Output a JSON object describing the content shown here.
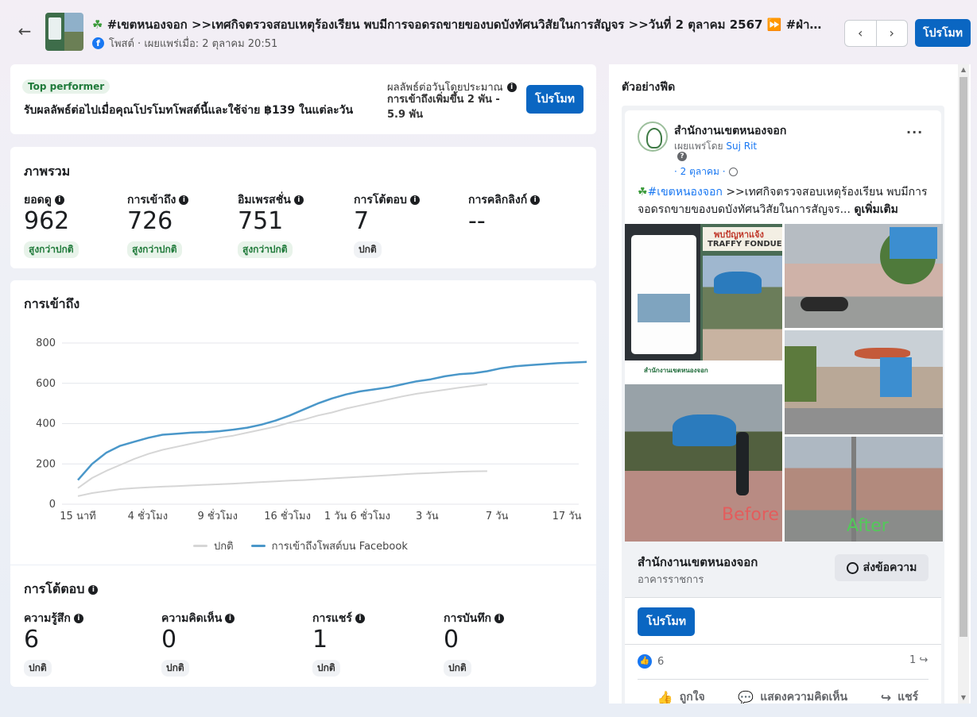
{
  "header": {
    "post_title": "#เขตหนองจอก >>เทศกิจตรวจสอบเหตุร้องเรียน พบมีการจอดรถขายของบดบังทัศนวิสัยในการสัญจร >>วันที่ 2 ตุลาคม 2567 ⏩ #ฝ่า…",
    "post_meta": "โพสต์ · เผยแพร่เมื่อ: 2 ตุลาคม 20:51",
    "prev_label": "‹",
    "next_label": "›",
    "promote_label": "โปรโมท"
  },
  "top_performer": {
    "badge": "Top performer",
    "message": "รับผลลัพธ์ต่อไปเมื่อคุณโปรโมทโพสต์นี้และใช้จ่าย ฿139 ในแต่ละวัน",
    "estimate_label": "ผลลัพธ์ต่อวันโดยประมาณ",
    "estimate_value": "การเข้าถึงเพิ่มขึ้น 2 พัน - 5.9 พัน",
    "promote_label": "โปรโมท"
  },
  "overview": {
    "title": "ภาพรวม",
    "metrics": [
      {
        "label": "ยอดดู",
        "value": "962",
        "badge": "สูงกว่าปกติ"
      },
      {
        "label": "การเข้าถึง",
        "value": "726",
        "badge": "สูงกว่าปกติ"
      },
      {
        "label": "อิมเพรสชั่น",
        "value": "751",
        "badge": "สูงกว่าปกติ"
      },
      {
        "label": "การโต้ตอบ",
        "value": "7",
        "badge": "ปกติ"
      },
      {
        "label": "การคลิกลิงก์",
        "value": "--",
        "badge": ""
      }
    ]
  },
  "reach": {
    "title": "การเข้าถึง",
    "legend_normal": "ปกติ",
    "legend_fb": "การเข้าถึงโพสต์บน Facebook"
  },
  "chart_data": {
    "type": "line",
    "title": "การเข้าถึง",
    "xlabel": "",
    "ylabel": "",
    "ylim": [
      0,
      800
    ],
    "yticks": [
      0,
      200,
      400,
      600,
      800
    ],
    "x_tick_labels": [
      "15 นาที",
      "4 ชั่วโมง",
      "9 ชั่วโมง",
      "16 ชั่วโมง",
      "1 วัน 6 ชั่วโมง",
      "3 วัน",
      "7 วัน",
      "17 วัน"
    ],
    "grid": true,
    "legend_position": "bottom",
    "series": [
      {
        "name": "การเข้าถึงโพสต์บน Facebook",
        "color": "#4a97c9",
        "values": [
          120,
          200,
          255,
          290,
          310,
          330,
          345,
          350,
          355,
          358,
          362,
          370,
          380,
          395,
          415,
          440,
          470,
          500,
          525,
          545,
          560,
          570,
          580,
          595,
          610,
          620,
          635,
          645,
          650,
          660,
          675,
          685,
          690,
          695,
          700,
          703,
          706,
          725
        ]
      },
      {
        "name": "ปกติ",
        "color": "#d6d6d6",
        "values": [
          80,
          130,
          165,
          195,
          225,
          250,
          270,
          285,
          300,
          315,
          330,
          340,
          355,
          370,
          385,
          405,
          420,
          440,
          455,
          475,
          490,
          505,
          520,
          535,
          548,
          558,
          568,
          578,
          587,
          595
        ]
      },
      {
        "name": "ปกติ",
        "color": "#d6d6d6",
        "values": [
          40,
          55,
          65,
          75,
          80,
          84,
          87,
          90,
          93,
          96,
          99,
          102,
          106,
          110,
          113,
          117,
          120,
          124,
          128,
          132,
          136,
          140,
          144,
          148,
          152,
          155,
          158,
          161,
          163,
          164
        ]
      }
    ]
  },
  "engagement": {
    "title": "การโต้ตอบ",
    "metrics": [
      {
        "label": "ความรู้สึก",
        "value": "6",
        "badge": "ปกติ"
      },
      {
        "label": "ความคิดเห็น",
        "value": "0",
        "badge": "ปกติ"
      },
      {
        "label": "การแชร์",
        "value": "1",
        "badge": "ปกติ"
      },
      {
        "label": "การบันทึก",
        "value": "0",
        "badge": "ปกติ"
      }
    ]
  },
  "feed_preview": {
    "title": "ตัวอย่างฟีด",
    "page_name": "สำนักงานเขตหนองจอก",
    "published_by_prefix": "เผยแพร่โดย",
    "published_by_user": "Suj Rit",
    "date": "· 2 ตุลาคม ·",
    "text_tag": "#เขตหนองจอก",
    "text_body": " >>เทศกิจตรวจสอบเหตุร้องเรียน พบมีการจอดรถขายของบดบังทัศนวิสัยในการสัญจร...",
    "see_more": "ดูเพิ่มเติม",
    "image_banner_1": "พบปัญหาแจ้ง",
    "image_banner_2": "TRAFFY FONDUE",
    "image_footer": "สำนักงานเขตหนองจอก",
    "label_before": "Before",
    "label_after": "After",
    "footer_page_name": "สำนักงานเขตหนองจอก",
    "footer_category": "อาคารราชการ",
    "message_label": "ส่งข้อความ",
    "promote_label": "โปรโมท",
    "likes_count": "6",
    "shares_count": "1",
    "action_like": "ถูกใจ",
    "action_comment": "แสดงความคิดเห็น",
    "action_share": "แชร์"
  }
}
